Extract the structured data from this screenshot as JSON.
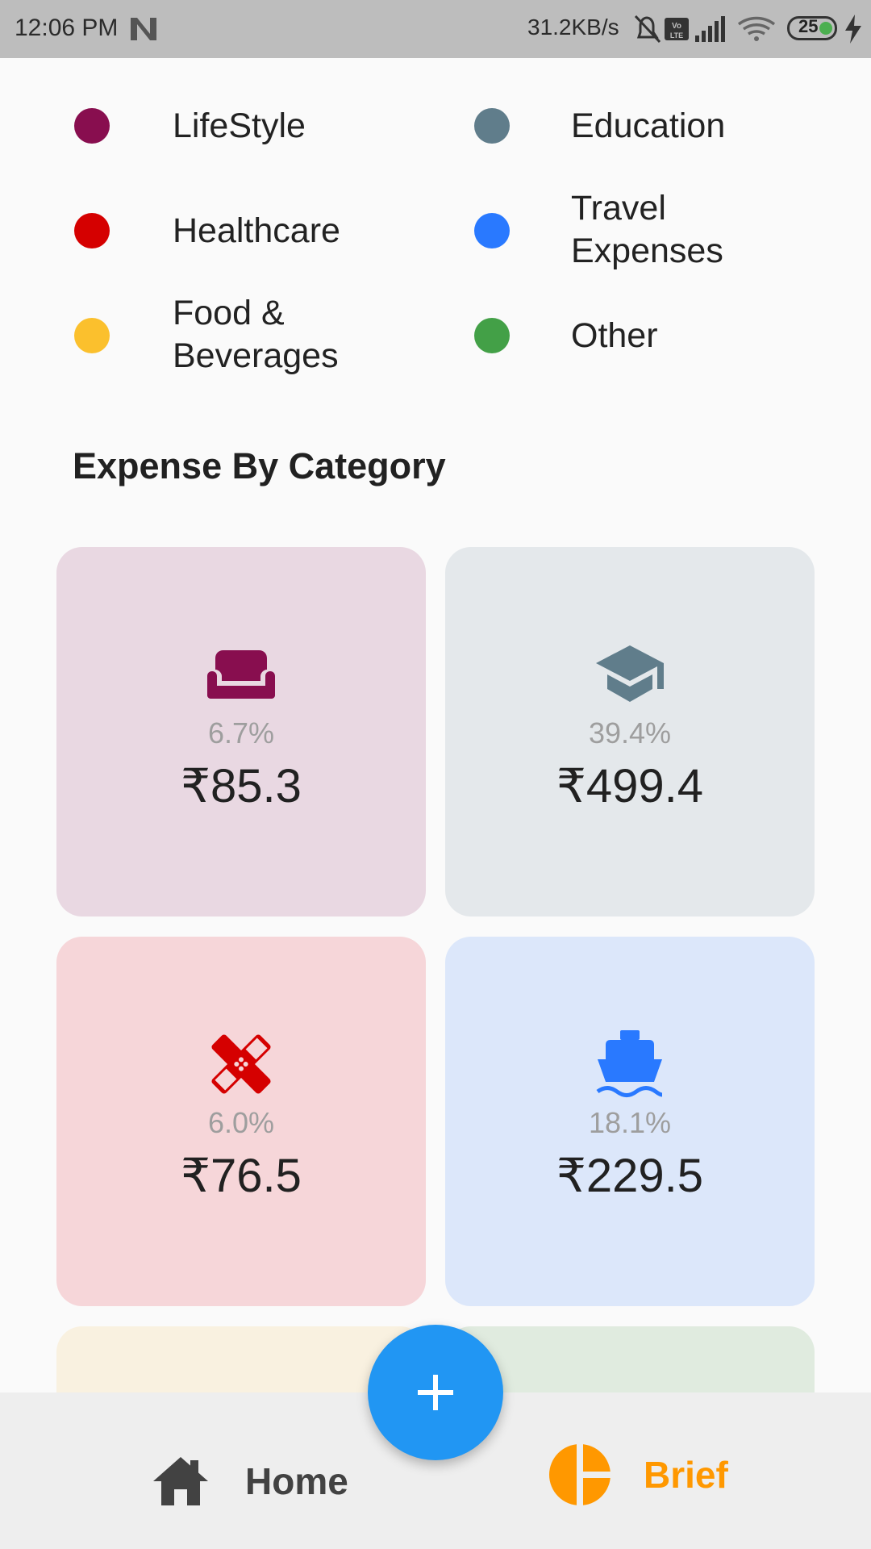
{
  "status_bar": {
    "time": "12:06 PM",
    "network_speed": "31.2KB/s",
    "battery": "25"
  },
  "legend": [
    {
      "label": "LifeStyle",
      "color": "#880e4f"
    },
    {
      "label": "Education",
      "color": "#607d8b"
    },
    {
      "label": "Healthcare",
      "color": "#d50000"
    },
    {
      "label": "Travel Expenses",
      "color": "#2979ff"
    },
    {
      "label": "Food & Beverages",
      "color": "#fbc02d"
    },
    {
      "label": "Other",
      "color": "#43a047"
    }
  ],
  "section_title": "Expense By Category",
  "cards": [
    {
      "category": "LifeStyle",
      "icon": "sofa-icon",
      "percent": "6.7%",
      "amount": "₹85.3",
      "color": "#880e4f",
      "bg": "#e9d8e2"
    },
    {
      "category": "Education",
      "icon": "graduation-cap-icon",
      "percent": "39.4%",
      "amount": "₹499.4",
      "color": "#607d8b",
      "bg": "#e4e8eb"
    },
    {
      "category": "Healthcare",
      "icon": "bandage-icon",
      "percent": "6.0%",
      "amount": "₹76.5",
      "color": "#d50000",
      "bg": "#f6d6d9"
    },
    {
      "category": "Travel Expenses",
      "icon": "ship-icon",
      "percent": "18.1%",
      "amount": "₹229.5",
      "color": "#2979ff",
      "bg": "#dce7fa"
    }
  ],
  "bottom_nav": {
    "home_label": "Home",
    "brief_label": "Brief",
    "active": "Brief",
    "active_color": "#ff9800"
  },
  "fab": {
    "icon": "plus-icon"
  }
}
